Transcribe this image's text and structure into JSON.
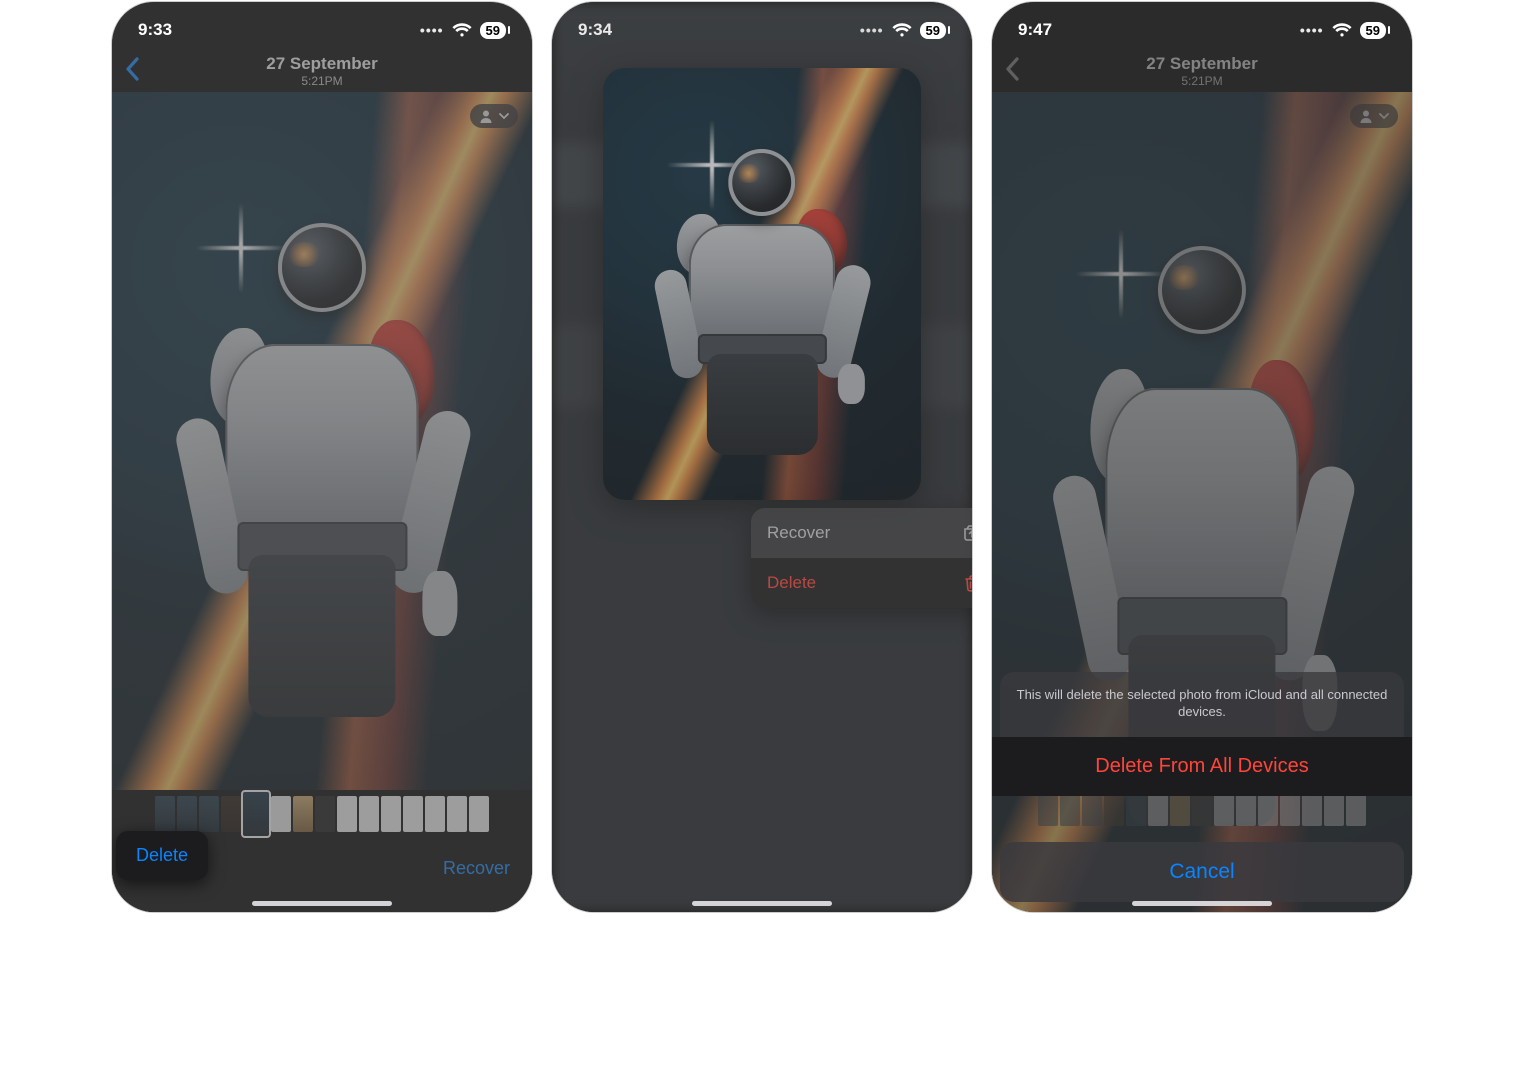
{
  "statusbar": {
    "battery": "59"
  },
  "screen1": {
    "time": "9:33",
    "header_title": "27 September",
    "header_subtitle": "5:21PM",
    "delete_label": "Delete",
    "recover_label": "Recover",
    "tooltip_delete": "Delete"
  },
  "screen2": {
    "time": "9:34",
    "menu_recover": "Recover",
    "menu_delete": "Delete"
  },
  "screen3": {
    "time": "9:47",
    "header_title": "27 September",
    "header_subtitle": "5:21PM",
    "sheet_message": "This will delete the selected photo from iCloud and all connected devices.",
    "sheet_delete": "Delete From All Devices",
    "sheet_cancel": "Cancel"
  },
  "colors": {
    "ios_blue": "#0a84ff",
    "ios_red": "#ff453a"
  }
}
